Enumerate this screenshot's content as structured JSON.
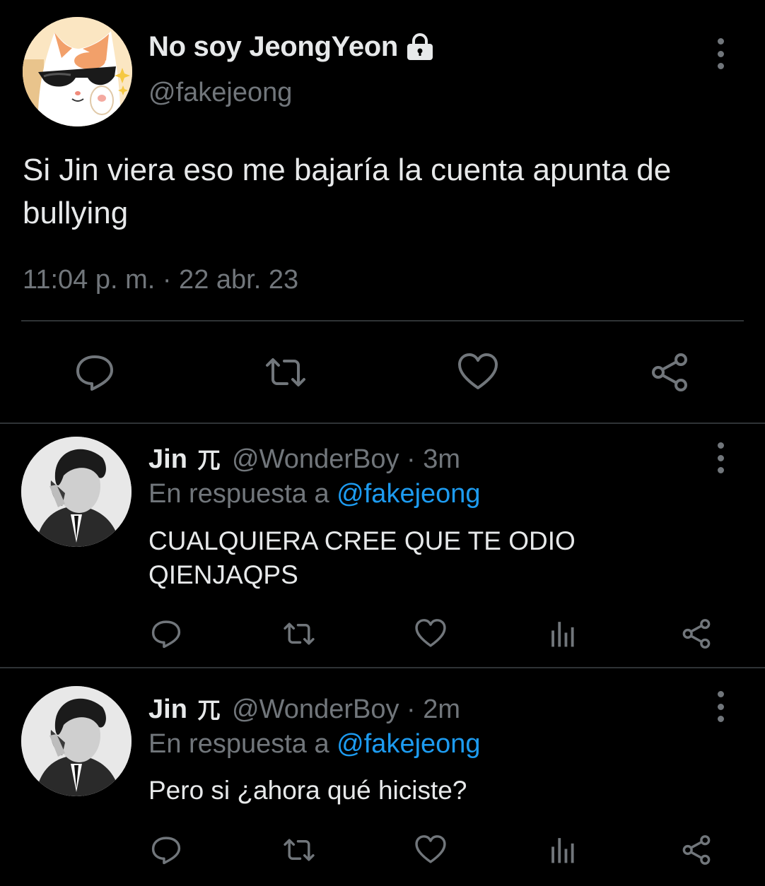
{
  "main_tweet": {
    "display_name": "No soy JeongYeon",
    "handle": "@fakejeong",
    "text": "Si Jin viera eso me bajaría la cuenta apunta de bullying",
    "timestamp": "11:04 p. m. · 22 abr. 23",
    "icons": [
      "lock-icon",
      "reply-icon",
      "retweet-icon",
      "like-icon",
      "share-icon",
      "more-icon"
    ]
  },
  "replies": [
    {
      "name": "Jin",
      "badge": "⺎",
      "handle": "@WonderBoy",
      "time_sep": " · ",
      "time": "3m",
      "reply_prefix": "En respuesta a ",
      "reply_to": "@fakejeong",
      "text_lines": [
        "CUALQUIERA CREE QUE TE ODIO",
        "QIENJAQPS"
      ]
    },
    {
      "name": "Jin",
      "badge": "⺎",
      "handle": "@WonderBoy",
      "time_sep": " · ",
      "time": "2m",
      "reply_prefix": "En respuesta a ",
      "reply_to": "@fakejeong",
      "text_lines": [
        "Pero si ¿ahora qué hiciste?"
      ]
    }
  ],
  "colors": {
    "background": "#000000",
    "text": "#e7e9ea",
    "secondary": "#71767b",
    "accent": "#1d9bf0",
    "divider": "#2f3336"
  }
}
